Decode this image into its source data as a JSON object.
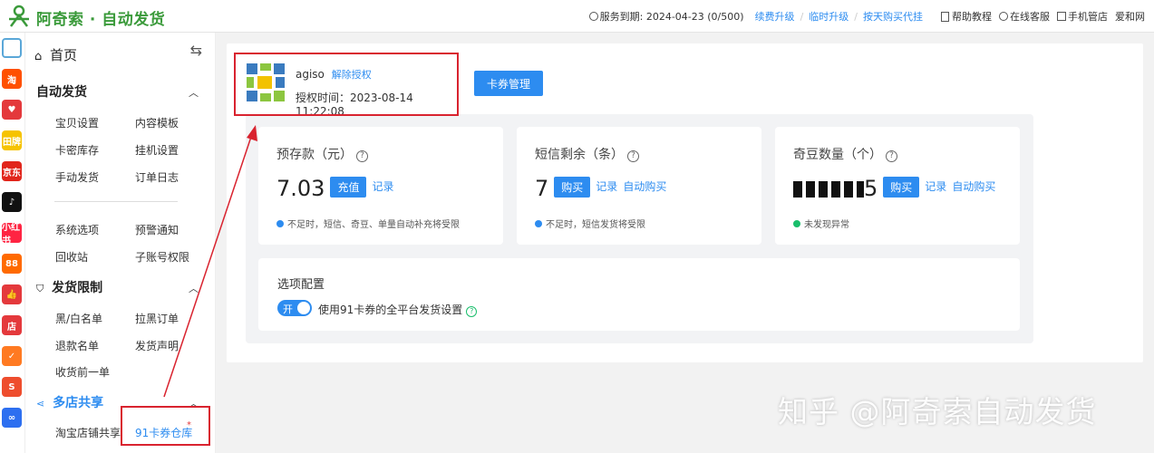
{
  "header": {
    "brand": "阿奇索 · 自动发货",
    "service_label": "服务到期: 2024-04-23 (0/500)",
    "renew": "续费升级",
    "temp_upgrade": "临时升级",
    "buy_daily": "按天购买代挂",
    "help": "帮助教程",
    "support": "在线客服",
    "phone_store": "手机管店",
    "aiwang": "爱和网"
  },
  "iconbar": [
    {
      "icon": "qr-grid-icon",
      "label": "",
      "color": "#5aa7d8"
    },
    {
      "icon": "taobao-icon",
      "label": "淘",
      "color": "#ff5000"
    },
    {
      "icon": "heart-icon",
      "label": "♥",
      "color": "#e4393c"
    },
    {
      "icon": "tianmao-icon",
      "label": "田牌",
      "color": "#f6c300"
    },
    {
      "icon": "jd-icon",
      "label": "京东",
      "color": "#e1251b"
    },
    {
      "icon": "tiktok-icon",
      "label": "♪",
      "color": "#111111"
    },
    {
      "icon": "xiaohongshu-icon",
      "label": "小红书",
      "color": "#ff2442"
    },
    {
      "icon": "circle-88-icon",
      "label": "88",
      "color": "#ff6a00"
    },
    {
      "icon": "thumb-icon",
      "label": "👍",
      "color": "#e4393c"
    },
    {
      "icon": "shop-icon",
      "label": "店",
      "color": "#e4393c"
    },
    {
      "icon": "orange-bag-icon",
      "label": "✓",
      "color": "#ff7a22"
    },
    {
      "icon": "shopee-icon",
      "label": "S",
      "color": "#ee4d2d"
    },
    {
      "icon": "link-icon",
      "label": "∞",
      "color": "#2d6ff0"
    }
  ],
  "sidebar": {
    "home": "首页",
    "sec1": "自动发货",
    "items1": [
      "宝贝设置",
      "内容模板",
      "卡密库存",
      "挂机设置",
      "手动发货",
      "订单日志",
      "系统选项",
      "预警通知",
      "回收站",
      "子账号权限"
    ],
    "sec2": "发货限制",
    "items2": [
      "黑/白名单",
      "拉黑订单",
      "退款名单",
      "发货声明",
      "收货前一单"
    ],
    "sec3": "多店共享",
    "items3": [
      "淘宝店铺共享",
      "91卡券仓库"
    ]
  },
  "account": {
    "name": "agiso",
    "unbind": "解除授权",
    "auth_time": "授权时间：2023-08-14 11:22:08",
    "card_mgmt": "卡券管理"
  },
  "stats": [
    {
      "title": "预存款（元）",
      "value": "7.03",
      "btn": "充值",
      "link1": "记录",
      "link2": "",
      "note": "不足时，短信、奇豆、单量自动补充将受限",
      "dot_color": "#2d8cf0"
    },
    {
      "title": "短信剩余（条）",
      "value": "7",
      "btn": "购买",
      "link1": "记录",
      "link2": "自动购买",
      "note": "不足时，短信发货将受限",
      "dot_color": "#2d8cf0"
    },
    {
      "title": "奇豆数量（个）",
      "value": "5",
      "btn": "购买",
      "link1": "记录",
      "link2": "自动购买",
      "note": "未发现异常",
      "dot_color": "#19be6b"
    }
  ],
  "options": {
    "title": "选项配置",
    "switch_text": "开",
    "switch_label": "使用91卡券的全平台发货设置"
  },
  "watermark": "知乎 @阿奇索自动发货"
}
